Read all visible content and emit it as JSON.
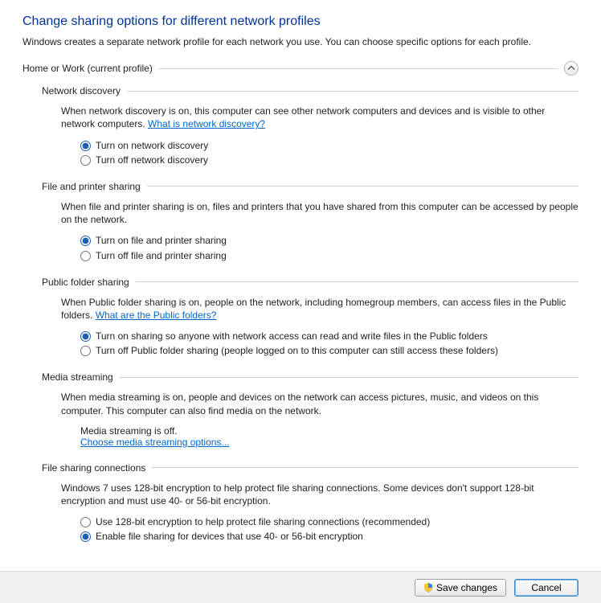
{
  "page": {
    "title": "Change sharing options for different network profiles",
    "intro": "Windows creates a separate network profile for each network you use. You can choose specific options for each profile."
  },
  "profile": {
    "name": "Home or Work (current profile)"
  },
  "sections": {
    "discovery": {
      "title": "Network discovery",
      "desc_pre": "When network discovery is on, this computer can see other network computers and devices and is visible to other network computers. ",
      "link": "What is network discovery?",
      "opt_on": "Turn on network discovery",
      "opt_off": "Turn off network discovery"
    },
    "fileprint": {
      "title": "File and printer sharing",
      "desc": "When file and printer sharing is on, files and printers that you have shared from this computer can be accessed by people on the network.",
      "opt_on": "Turn on file and printer sharing",
      "opt_off": "Turn off file and printer sharing"
    },
    "publicfolder": {
      "title": "Public folder sharing",
      "desc_pre": "When Public folder sharing is on, people on the network, including homegroup members, can access files in the Public folders. ",
      "link": "What are the Public folders?",
      "opt_on": "Turn on sharing so anyone with network access can read and write files in the Public folders",
      "opt_off": "Turn off Public folder sharing (people logged on to this computer can still access these folders)"
    },
    "media": {
      "title": "Media streaming",
      "desc": "When media streaming is on, people and devices on the network can access pictures, music, and videos on this computer. This computer can also find media on the network.",
      "status": "Media streaming is off.",
      "link": "Choose media streaming options..."
    },
    "encryption": {
      "title": "File sharing connections",
      "desc": "Windows 7 uses 128-bit encryption to help protect file sharing connections. Some devices don't support 128-bit encryption and must use 40- or 56-bit encryption.",
      "opt_128": "Use 128-bit encryption to help protect file sharing connections (recommended)",
      "opt_40": "Enable file sharing for devices that use 40- or 56-bit encryption"
    }
  },
  "buttons": {
    "save": "Save changes",
    "cancel": "Cancel"
  }
}
